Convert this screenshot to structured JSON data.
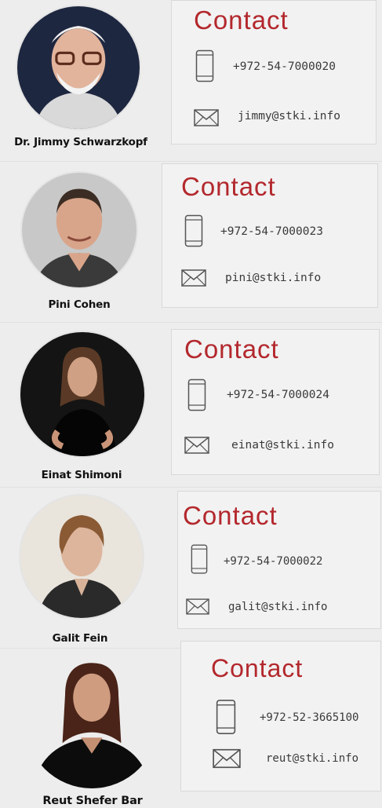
{
  "contacts": [
    {
      "name": "Dr. Jimmy Schwarzkopf",
      "heading": "Contact",
      "phone": "+972-54-7000020",
      "email": "jimmy@stki.info"
    },
    {
      "name": "Pini Cohen",
      "heading": "Contact",
      "phone": "+972-54-7000023",
      "email": "pini@stki.info"
    },
    {
      "name": "Einat Shimoni",
      "heading": "Contact",
      "phone": "+972-54-7000024",
      "email": "einat@stki.info"
    },
    {
      "name": "Galit Fein",
      "heading": "Contact",
      "phone": "+972-54-7000022",
      "email": "galit@stki.info"
    },
    {
      "name": "Reut Shefer Bar",
      "heading": "Contact",
      "phone": "+972-52-3665100",
      "email": "reut@stki.info"
    }
  ],
  "icons": {
    "phone": "phone-icon",
    "email": "mail-icon",
    "photo": "person-photo"
  },
  "colors": {
    "accent": "#b3282d",
    "text": "#3a3a3a",
    "background": "#ededed"
  }
}
